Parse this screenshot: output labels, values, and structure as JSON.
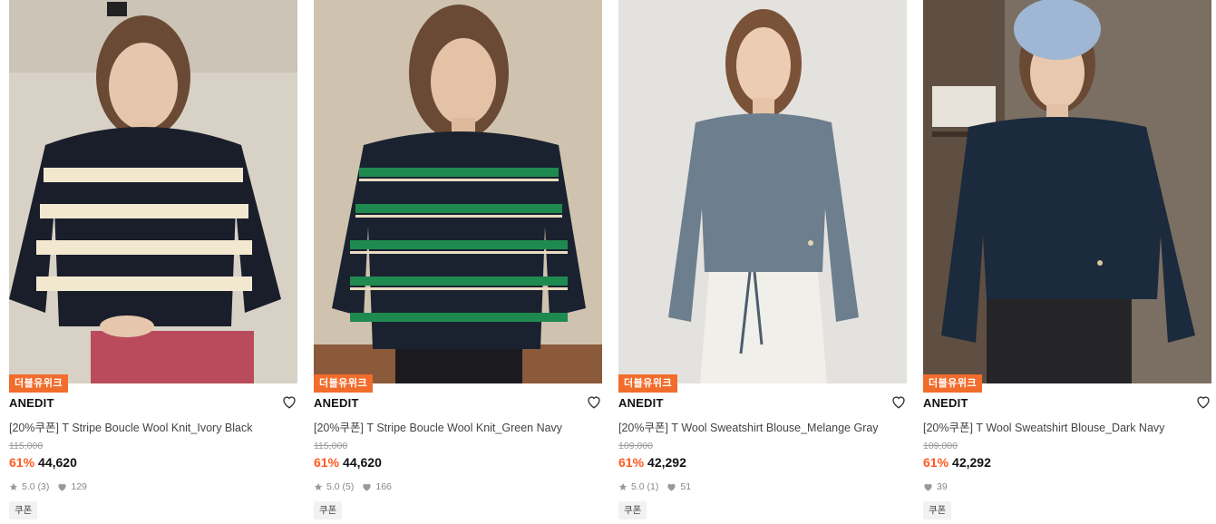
{
  "products": [
    {
      "badge": "더블유위크",
      "brand": "ANEDIT",
      "title": "[20%쿠폰] T Stripe Boucle Wool Knit_Ivory Black",
      "original_price": "115,000",
      "discount": "61%",
      "price": "44,620",
      "rating": "5.0",
      "review_count": "(3)",
      "likes": "129",
      "coupon": "쿠폰",
      "bg": "#d8d2c6",
      "garment": "#1a1e2b",
      "stripe": "#f2e8cf"
    },
    {
      "badge": "더블유위크",
      "brand": "ANEDIT",
      "title": "[20%쿠폰] T Stripe Boucle Wool Knit_Green Navy",
      "original_price": "115,000",
      "discount": "61%",
      "price": "44,620",
      "rating": "5.0",
      "review_count": "(5)",
      "likes": "166",
      "coupon": "쿠폰",
      "bg": "#cfc3b0",
      "garment": "#1a2230",
      "stripe": "#1f8a4f"
    },
    {
      "badge": "더블유위크",
      "brand": "ANEDIT",
      "title": "[20%쿠폰] T Wool Sweatshirt Blouse_Melange Gray",
      "original_price": "109,000",
      "discount": "61%",
      "price": "42,292",
      "rating": "5.0",
      "review_count": "(1)",
      "likes": "51",
      "coupon": "쿠폰",
      "bg": "#e4e2df",
      "garment": "#6d7f8e",
      "stripe": ""
    },
    {
      "badge": "더블유위크",
      "brand": "ANEDIT",
      "title": "[20%쿠폰] T Wool Sweatshirt Blouse_Dark Navy",
      "original_price": "109,000",
      "discount": "61%",
      "price": "42,292",
      "rating": "",
      "review_count": "",
      "likes": "39",
      "coupon": "쿠폰",
      "bg": "#7a6f62",
      "garment": "#1b2a3c",
      "stripe": ""
    }
  ],
  "colors": {
    "badge": "#f26c2c",
    "discount": "#ff5a1f"
  }
}
